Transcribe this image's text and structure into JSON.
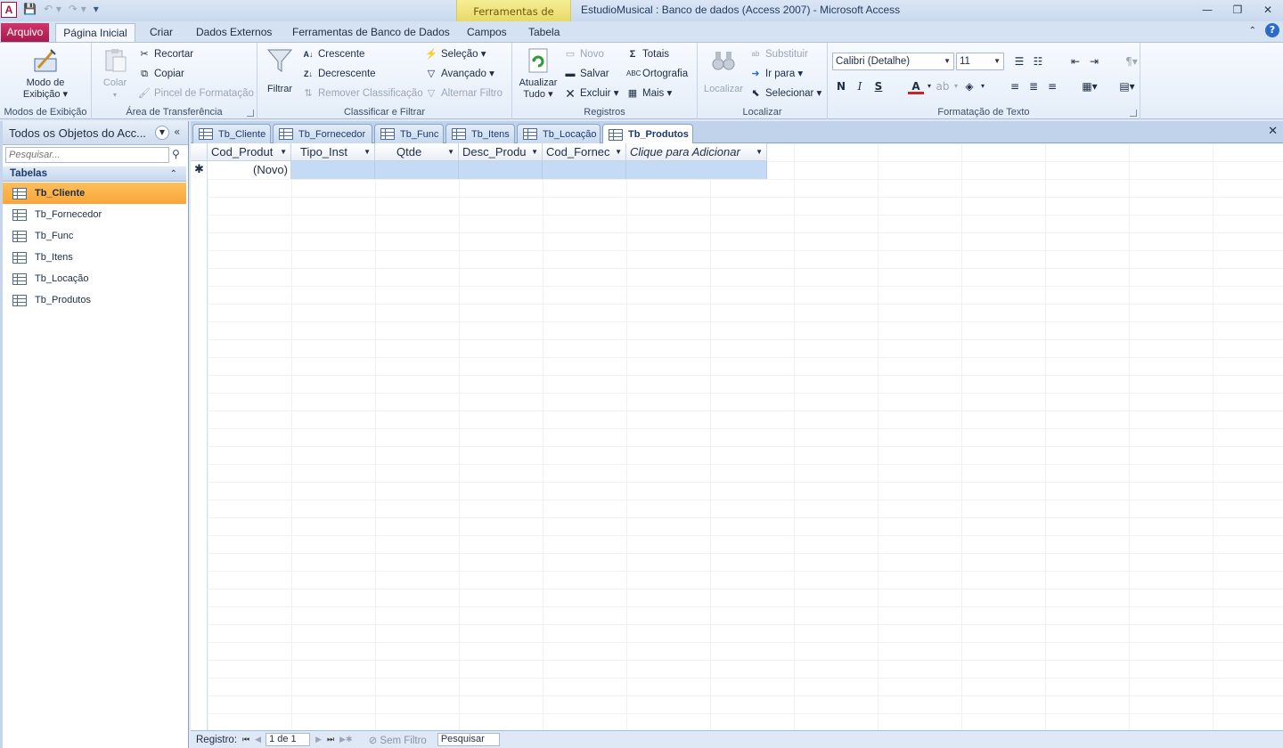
{
  "window": {
    "title": "EstudioMusical : Banco de dados (Access 2007)  -  Microsoft Access",
    "context_group": "Ferramentas de Tabela",
    "app_letter": "A"
  },
  "tabs": {
    "file": "Arquivo",
    "home": "Página Inicial",
    "create": "Criar",
    "external": "Dados Externos",
    "dbtools": "Ferramentas de Banco de Dados",
    "fields": "Campos",
    "table": "Tabela"
  },
  "ribbon": {
    "views": {
      "label": "Modos de Exibição",
      "btn_line1": "Modo de",
      "btn_line2": "Exibição ▾"
    },
    "clipboard": {
      "label": "Área de Transferência",
      "paste": "Colar",
      "cut": "Recortar",
      "copy": "Copiar",
      "format_painter": "Pincel de Formatação"
    },
    "sort_filter": {
      "label": "Classificar e Filtrar",
      "filter": "Filtrar",
      "ascending": "Crescente",
      "descending": "Decrescente",
      "remove_sort": "Remover Classificação",
      "selection": "Seleção ▾",
      "advanced": "Avançado ▾",
      "toggle_filter": "Alternar Filtro"
    },
    "records": {
      "label": "Registros",
      "refresh_line1": "Atualizar",
      "refresh_line2": "Tudo ▾",
      "new": "Novo",
      "save": "Salvar",
      "delete": "Excluir ▾",
      "totals": "Totais",
      "spelling": "Ortografia",
      "more": "Mais ▾"
    },
    "find": {
      "label": "Localizar",
      "find": "Localizar",
      "replace": "Substituir",
      "goto": "Ir para ▾",
      "select": "Selecionar ▾"
    },
    "text_format": {
      "label": "Formatação de Texto",
      "font": "Calibri (Detalhe)",
      "size": "11",
      "bold": "N",
      "italic": "I",
      "underline": "S"
    }
  },
  "nav": {
    "title": "Todos os Objetos do Acc...",
    "search_placeholder": "Pesquisar...",
    "group": "Tabelas",
    "items": [
      {
        "label": "Tb_Cliente"
      },
      {
        "label": "Tb_Fornecedor"
      },
      {
        "label": "Tb_Func"
      },
      {
        "label": "Tb_Itens"
      },
      {
        "label": "Tb_Locação"
      },
      {
        "label": "Tb_Produtos"
      }
    ]
  },
  "doc_tabs": [
    "Tb_Cliente",
    "Tb_Fornecedor",
    "Tb_Func",
    "Tb_Itens",
    "Tb_Locação",
    "Tb_Produtos"
  ],
  "datasheet": {
    "columns": [
      "Cod_Produt",
      "Tipo_Inst",
      "Qtde",
      "Desc_Produ",
      "Cod_Fornec",
      "Clique para Adicionar"
    ],
    "new_row_text": "(Novo)",
    "new_row_marker": "✱"
  },
  "recnav": {
    "label": "Registro:",
    "position": "1 de 1",
    "filter": "Sem Filtro",
    "search": "Pesquisar"
  }
}
